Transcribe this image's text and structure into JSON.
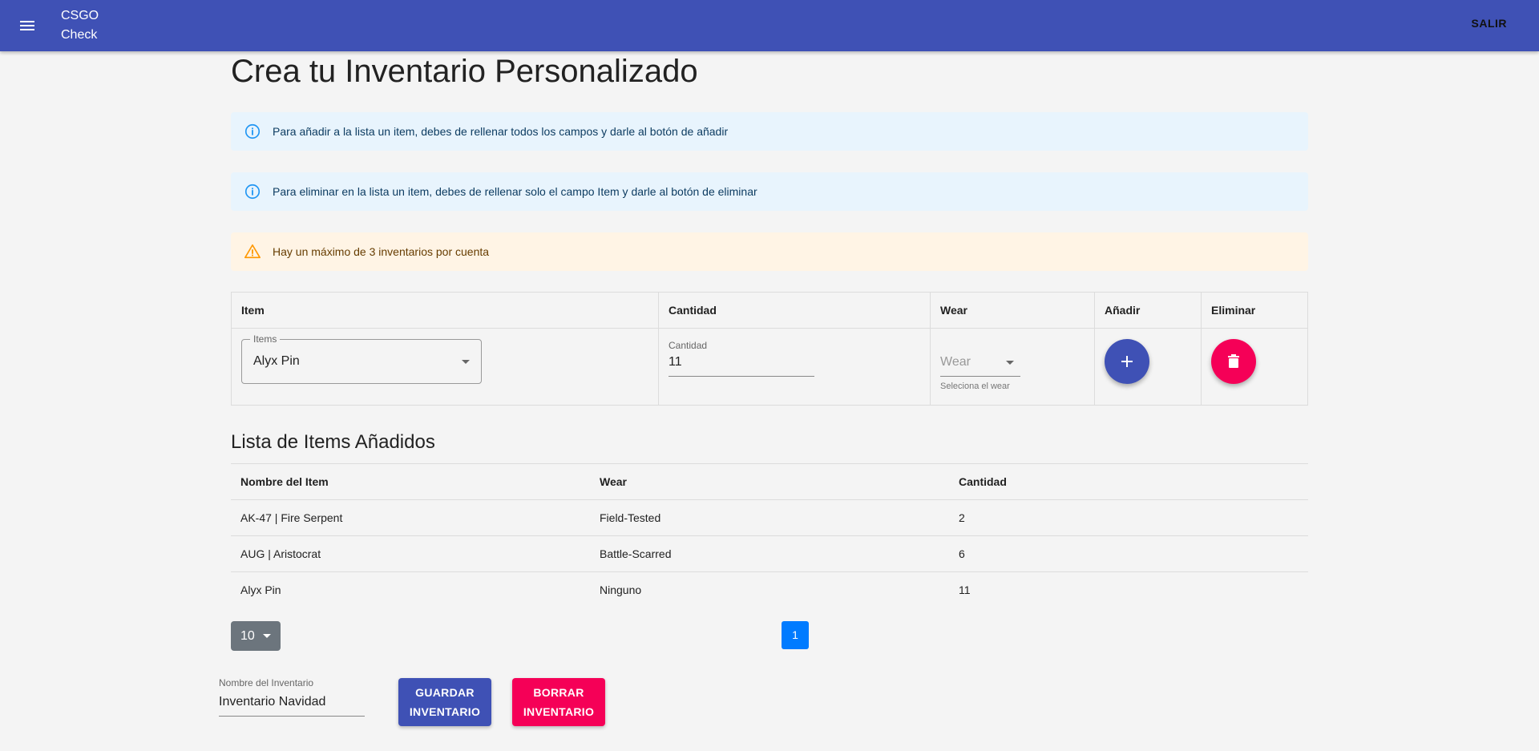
{
  "appbar": {
    "brand_line1": "CSGO",
    "brand_line2": "Check",
    "logout_label": "SALIR",
    "color": "#3f51b5"
  },
  "page": {
    "title": "Crea tu Inventario Personalizado"
  },
  "alerts": [
    {
      "type": "info",
      "icon": "info-icon",
      "text": "Para añadir a la lista un item, debes de rellenar todos los campos y darle al botón de añadir"
    },
    {
      "type": "info",
      "icon": "info-icon",
      "text": "Para eliminar en la lista un item, debes de rellenar solo el campo Item y darle al botón de eliminar"
    },
    {
      "type": "warning",
      "icon": "warning-icon",
      "text": "Hay un máximo de 3 inventarios por cuenta"
    }
  ],
  "item_form": {
    "headers": [
      "Item",
      "Cantidad",
      "Wear",
      "Añadir",
      "Eliminar"
    ],
    "item_select": {
      "label": "Items",
      "value": "Alyx Pin"
    },
    "cantidad": {
      "label": "Cantidad",
      "value": "11"
    },
    "wear": {
      "placeholder": "Wear",
      "helper": "Seleciona el wear"
    },
    "add_icon": "plus-icon",
    "delete_icon": "trash-icon"
  },
  "list": {
    "title": "Lista de Items Añadidos",
    "columns": [
      "Nombre del Item",
      "Wear",
      "Cantidad"
    ],
    "rows": [
      {
        "name": "AK-47 | Fire Serpent",
        "wear": "Field-Tested",
        "cantidad": "2"
      },
      {
        "name": "AUG | Aristocrat",
        "wear": "Battle-Scarred",
        "cantidad": "6"
      },
      {
        "name": "Alyx Pin",
        "wear": "Ninguno",
        "cantidad": "11"
      }
    ]
  },
  "pagination": {
    "page_size": "10",
    "current_page": "1"
  },
  "inventory": {
    "name_label": "Nombre del Inventario",
    "name_value": "Inventario Navidad",
    "save_line1": "GUARDAR",
    "save_line2": "INVENTARIO",
    "delete_line1": "BORRAR",
    "delete_line2": "INVENTARIO"
  },
  "colors": {
    "primary": "#3f51b5",
    "secondary": "#f50057",
    "info_bg": "#e8f4fd",
    "warning_bg": "#fff4e5",
    "page_button": "#007bff"
  }
}
